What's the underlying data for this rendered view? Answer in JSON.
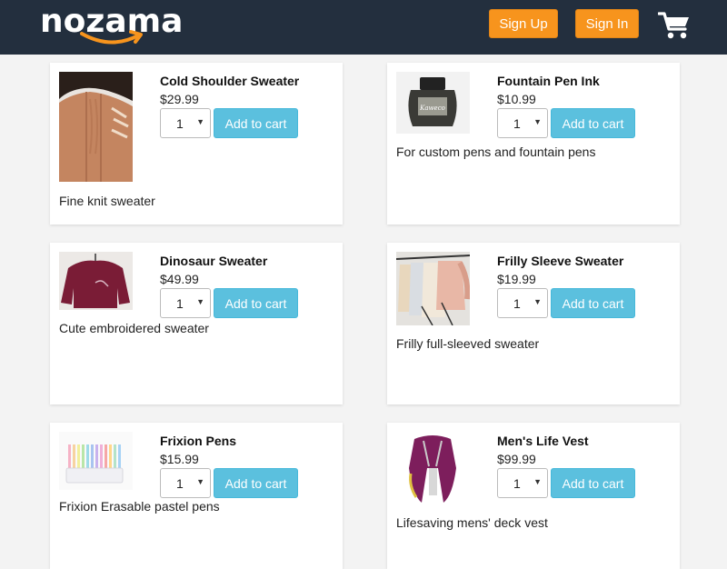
{
  "header": {
    "logo_text": "nozama",
    "signup_label": "Sign Up",
    "signin_label": "Sign In",
    "cart_icon": "shopping-cart-icon"
  },
  "colors": {
    "header_bg": "#232f3e",
    "accent_orange": "#f7941d",
    "button_blue": "#5bc0de"
  },
  "products": [
    {
      "name": "Cold Shoulder Sweater",
      "price": "$29.99",
      "qty": "1",
      "add_label": "Add to cart",
      "description": "Fine knit sweater"
    },
    {
      "name": "Fountain Pen Ink",
      "price": "$10.99",
      "qty": "1",
      "add_label": "Add to cart",
      "description": "For custom pens and fountain pens",
      "image_label": "Kaweco"
    },
    {
      "name": "Dinosaur Sweater",
      "price": "$49.99",
      "qty": "1",
      "add_label": "Add to cart",
      "description": "Cute embroidered sweater"
    },
    {
      "name": "Frilly Sleeve Sweater",
      "price": "$19.99",
      "qty": "1",
      "add_label": "Add to cart",
      "description": "Frilly full-sleeved sweater"
    },
    {
      "name": "Frixion Pens",
      "price": "$15.99",
      "qty": "1",
      "add_label": "Add to cart",
      "description": "Frixion Erasable pastel pens"
    },
    {
      "name": "Men's Life Vest",
      "price": "$99.99",
      "qty": "1",
      "add_label": "Add to cart",
      "description": "Lifesaving mens' deck vest"
    }
  ]
}
